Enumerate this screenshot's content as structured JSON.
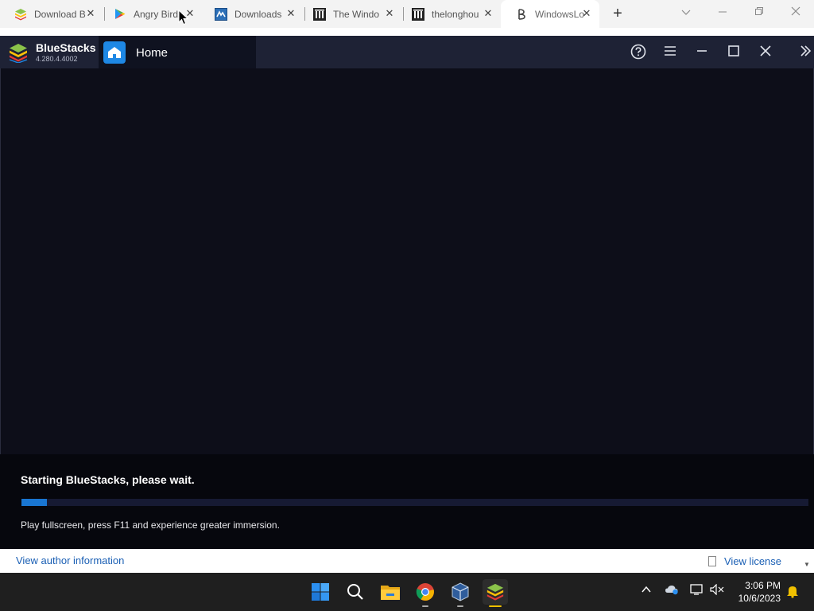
{
  "browser": {
    "tabs": [
      {
        "label": "Download B",
        "icon": "bluestacks-favicon",
        "active": false
      },
      {
        "label": "Angry Birds",
        "icon": "google-play-favicon",
        "active": false
      },
      {
        "label": "Downloads",
        "icon": "downloads-site-favicon",
        "active": false
      },
      {
        "label": "The Windo",
        "icon": "museum-building-favicon",
        "active": false
      },
      {
        "label": "thelonghou",
        "icon": "museum-building-favicon",
        "active": false
      },
      {
        "label": "WindowsLo",
        "icon": "windowsloop-favicon",
        "active": true
      }
    ],
    "new_tab": "+",
    "close_glyph": "✕"
  },
  "bluestacks": {
    "app_name": "BlueStacks",
    "version": "4.280.4.4002",
    "home_tab": "Home",
    "status": "Starting BlueStacks, please wait.",
    "progress_percent": 3.2,
    "tip": "Play fullscreen, press F11 and experience greater immersion.",
    "colors": {
      "title_bar": "#1e2235",
      "progress": "#1976d2",
      "home_icon": "#1e88e5"
    }
  },
  "installer": {
    "author_link": "View author information",
    "license_link": "View license"
  },
  "taskbar": {
    "apps": [
      "windows-start-icon",
      "search-icon",
      "file-explorer-icon",
      "chrome-icon",
      "virtualbox-icon",
      "bluestacks-icon"
    ],
    "clock_time": "3:06 PM",
    "clock_date": "10/6/2023"
  }
}
